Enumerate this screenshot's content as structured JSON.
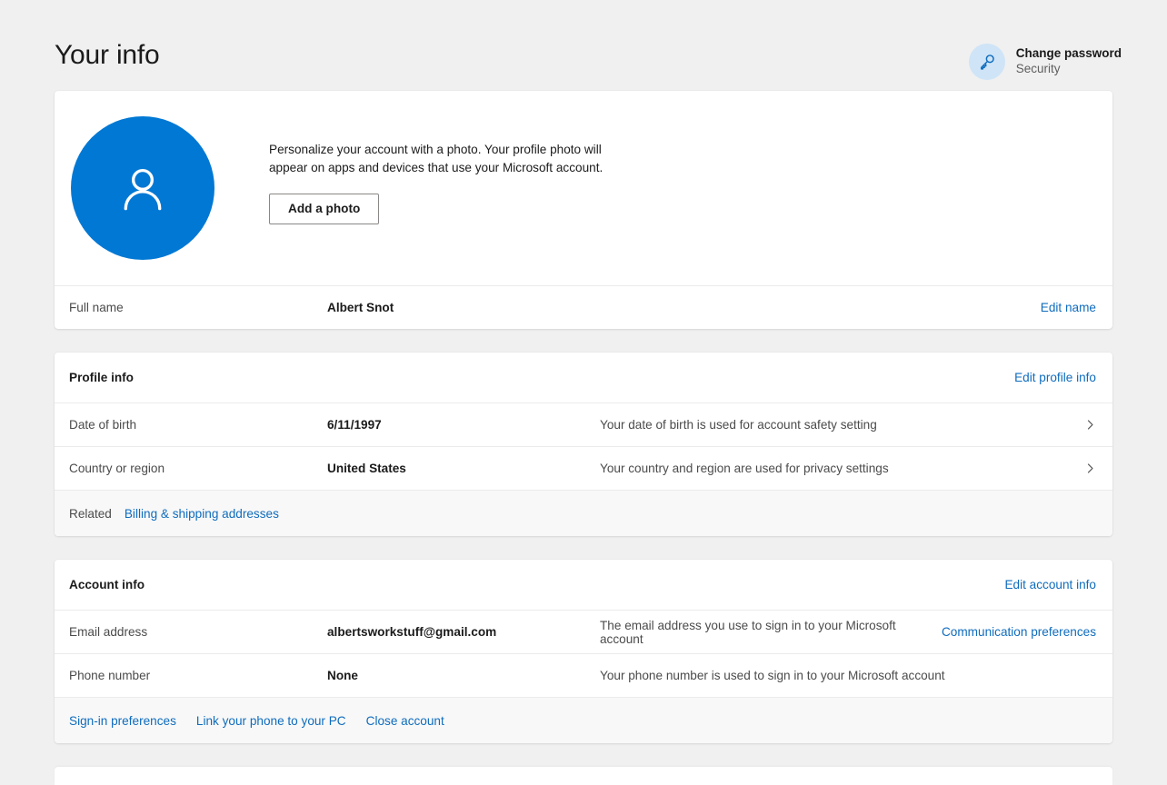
{
  "header": {
    "title": "Your info",
    "action": {
      "icon": "key-icon",
      "title": "Change password",
      "subtitle": "Security"
    }
  },
  "photo_card": {
    "avatar_icon": "person-icon",
    "description": "Personalize your account with a photo. Your profile photo will appear on apps and devices that use your Microsoft account.",
    "add_photo_button": "Add a photo",
    "full_name_row": {
      "label": "Full name",
      "value": "Albert Snot",
      "link": "Edit name"
    }
  },
  "profile_info": {
    "title": "Profile info",
    "edit_link": "Edit profile info",
    "rows": [
      {
        "label": "Date of birth",
        "value": "6/11/1997",
        "description": "Your date of birth is used for account safety setting",
        "chevron": "chevron-right-icon"
      },
      {
        "label": "Country or region",
        "value": "United States",
        "description": "Your country and region are used for privacy settings",
        "chevron": "chevron-right-icon"
      }
    ],
    "footer": {
      "label": "Related",
      "link": "Billing & shipping addresses"
    }
  },
  "account_info": {
    "title": "Account info",
    "edit_link": "Edit account info",
    "rows": [
      {
        "label": "Email address",
        "value": "albertsworkstuff@gmail.com",
        "description": "The email address you use to sign in to your Microsoft account",
        "link": "Communication preferences"
      },
      {
        "label": "Phone number",
        "value": "None",
        "description": "Your phone number is used to sign in to your Microsoft account",
        "link": ""
      }
    ],
    "footer_links": [
      "Sign-in preferences",
      "Link your phone to your PC",
      "Close account"
    ]
  },
  "colors": {
    "accent": "#0078d4",
    "link": "#0f6cbd",
    "page_background": "#f0f0f0",
    "card_background": "#ffffff",
    "footer_background": "#f8f8f8"
  }
}
